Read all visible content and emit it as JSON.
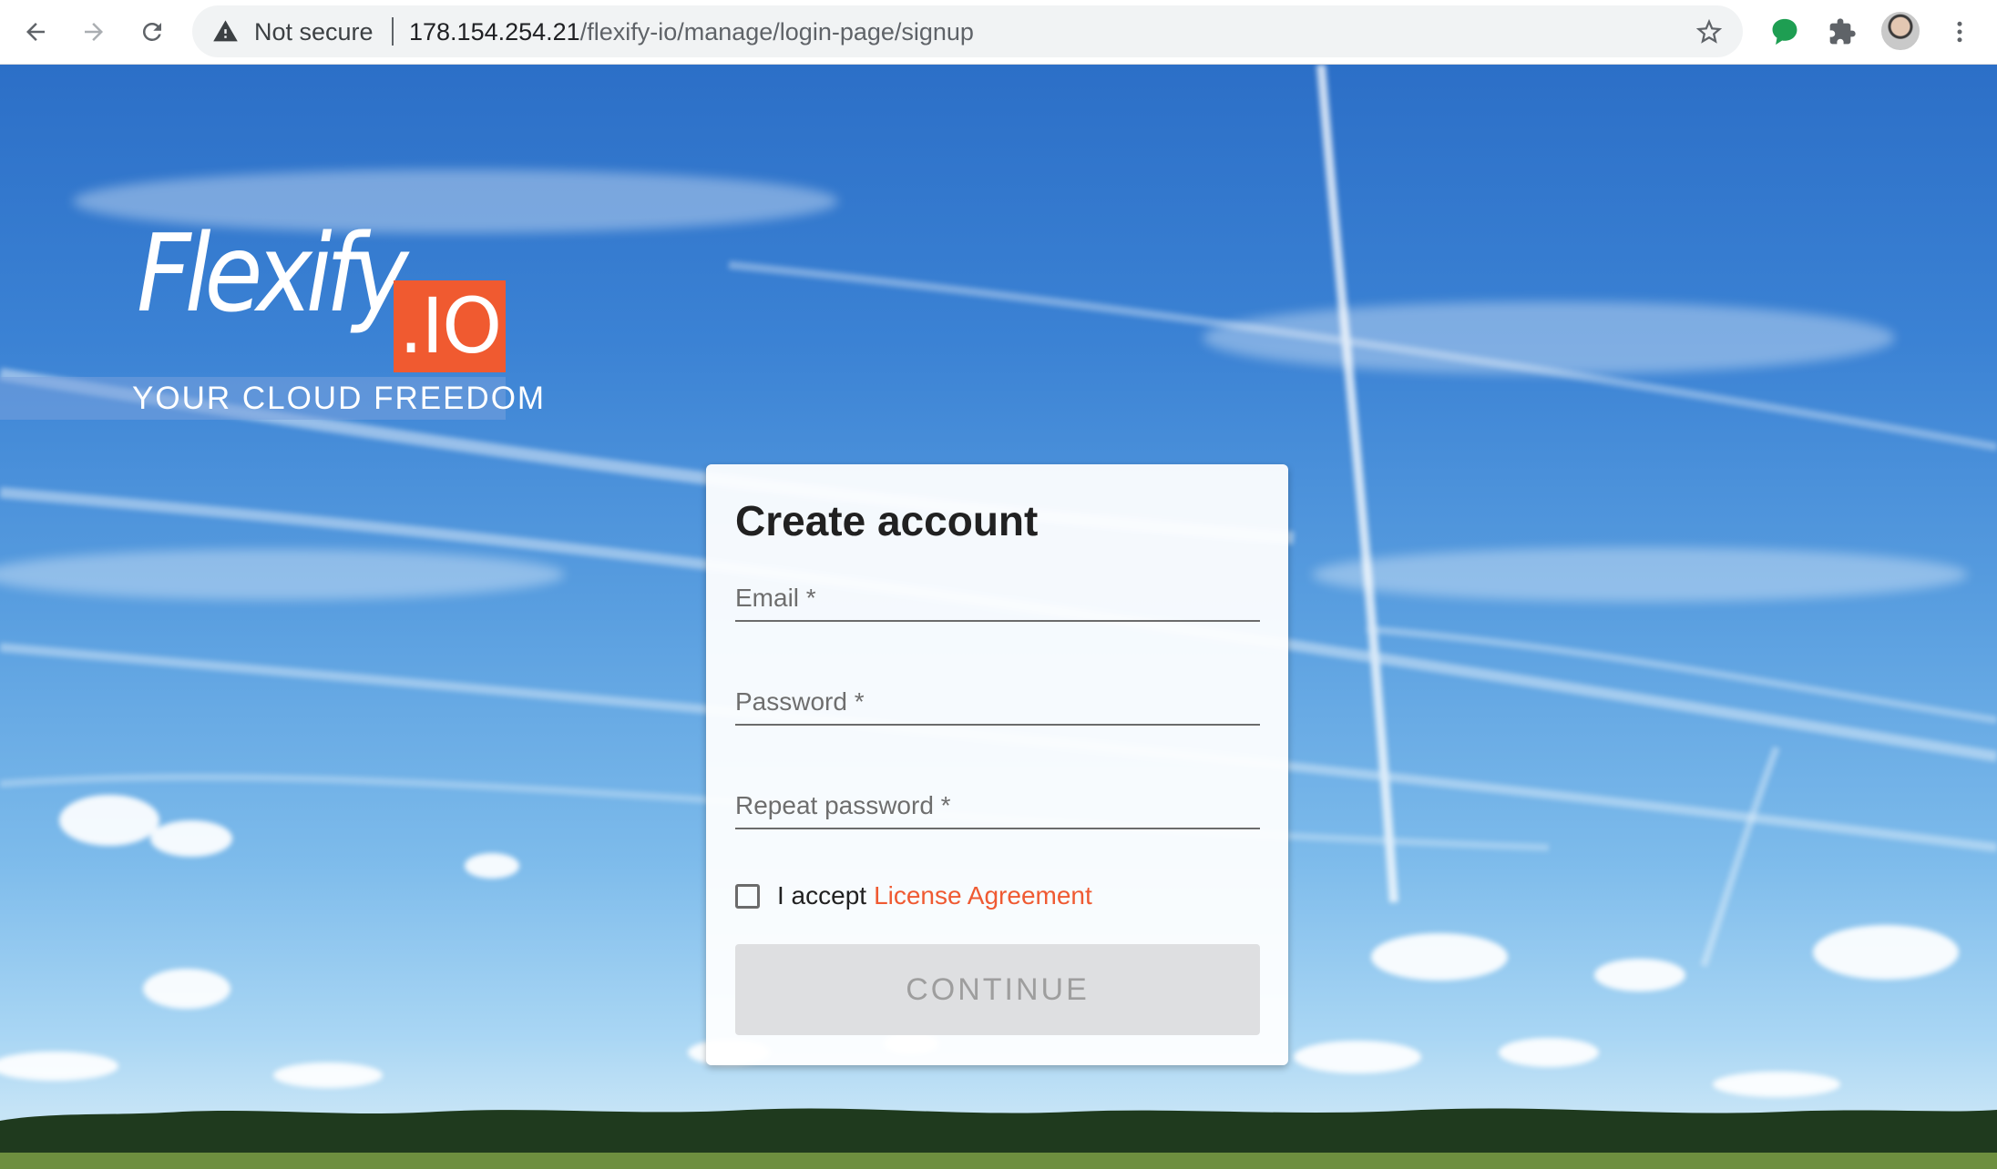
{
  "browser": {
    "security_label": "Not secure",
    "url_host": "178.154.254.21",
    "url_path": "/flexify-io/manage/login-page/signup"
  },
  "logo": {
    "wordmark": "Flexify",
    "badge": ".IO",
    "tagline": "YOUR CLOUD FREEDOM"
  },
  "form": {
    "title": "Create account",
    "email_label": "Email *",
    "password_label": "Password *",
    "repeat_password_label": "Repeat password *",
    "accept_text": "I accept",
    "license_link": "License Agreement",
    "continue_label": "CONTINUE"
  },
  "colors": {
    "accent": "#ef5a32",
    "sky_top": "#2c6fc7",
    "sky_bottom": "#c6e4f6",
    "button_disabled": "#dedfe1"
  },
  "icons": {
    "back": "arrow-left-icon",
    "forward": "arrow-right-icon",
    "reload": "reload-icon",
    "warning": "warning-triangle-icon",
    "bookmark": "star-icon",
    "extension_green": "speech-bubble-icon",
    "extensions": "puzzle-icon",
    "menu": "kebab-menu-icon"
  }
}
